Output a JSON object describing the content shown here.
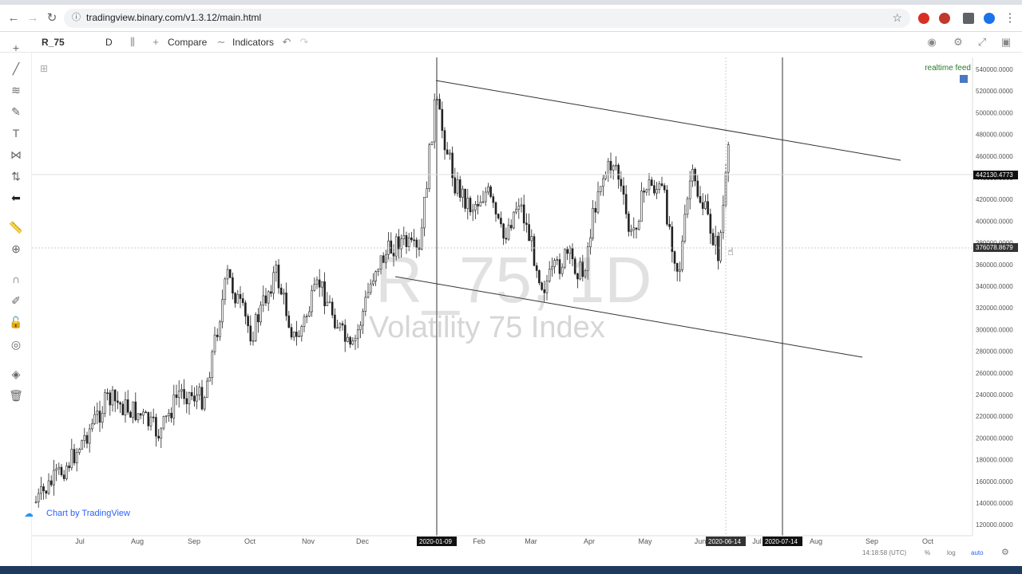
{
  "browser": {
    "url": "tradingview.binary.com/v1.3.12/main.html"
  },
  "toolbar": {
    "symbol": "R_75",
    "interval": "D",
    "compare_label": "Compare",
    "indicators_label": "Indicators"
  },
  "chart": {
    "realtime_label": "realtime feed",
    "watermark_symbol": "R_75, 1D",
    "watermark_desc": "Volatility 75 Index",
    "credit_label": "Chart by TradingView",
    "current_price": "442130.4773",
    "cursor_price": "376078.8679",
    "crosshair_date_1": "2020-01-09",
    "crosshair_date_2": "2020-06-14",
    "crosshair_date_3": "2020-07-14",
    "price_ticks": [
      "540000.0000",
      "520000.0000",
      "500000.0000",
      "480000.0000",
      "460000.0000",
      "440000.0000",
      "420000.0000",
      "400000.0000",
      "380000.0000",
      "360000.0000",
      "340000.0000",
      "320000.0000",
      "300000.0000",
      "280000.0000",
      "260000.0000",
      "240000.0000",
      "220000.0000",
      "200000.0000",
      "180000.0000",
      "160000.0000",
      "140000.0000",
      "120000.0000"
    ],
    "time_ticks": [
      "Jul",
      "Aug",
      "Sep",
      "Oct",
      "Nov",
      "Dec",
      "Feb",
      "Mar",
      "Apr",
      "May",
      "Jun",
      "Jul",
      "Aug",
      "Sep",
      "Oct"
    ]
  },
  "bottom": {
    "clock": "14:18:58 (UTC)",
    "percent": "%",
    "log": "log",
    "auto": "auto"
  },
  "colors": {
    "accent": "#2962ff",
    "realtime": "#2a7a2a"
  }
}
